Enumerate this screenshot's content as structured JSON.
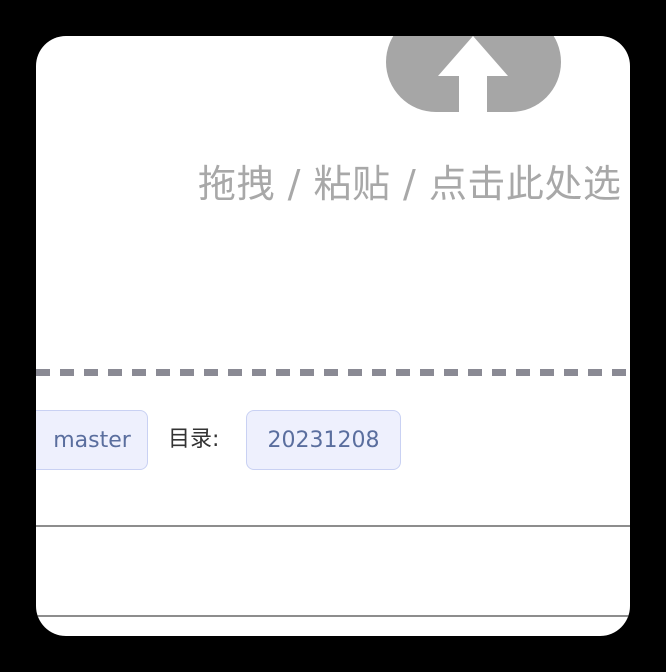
{
  "upload": {
    "icon": "cloud-upload-icon",
    "hint": "拖拽 / 粘贴 / 点击此处选"
  },
  "repo": {
    "branch_value": "master",
    "directory_label": "目录:",
    "directory_value": "20231208"
  },
  "colors": {
    "background": "#000000",
    "card": "#ffffff",
    "icon": "#a6a6a6",
    "hint_text": "#a8a8a8",
    "dash": "#8a8a94",
    "tag_bg": "#eef0fd",
    "tag_border": "#c9d1f3",
    "tag_text": "#5a6e9e"
  }
}
